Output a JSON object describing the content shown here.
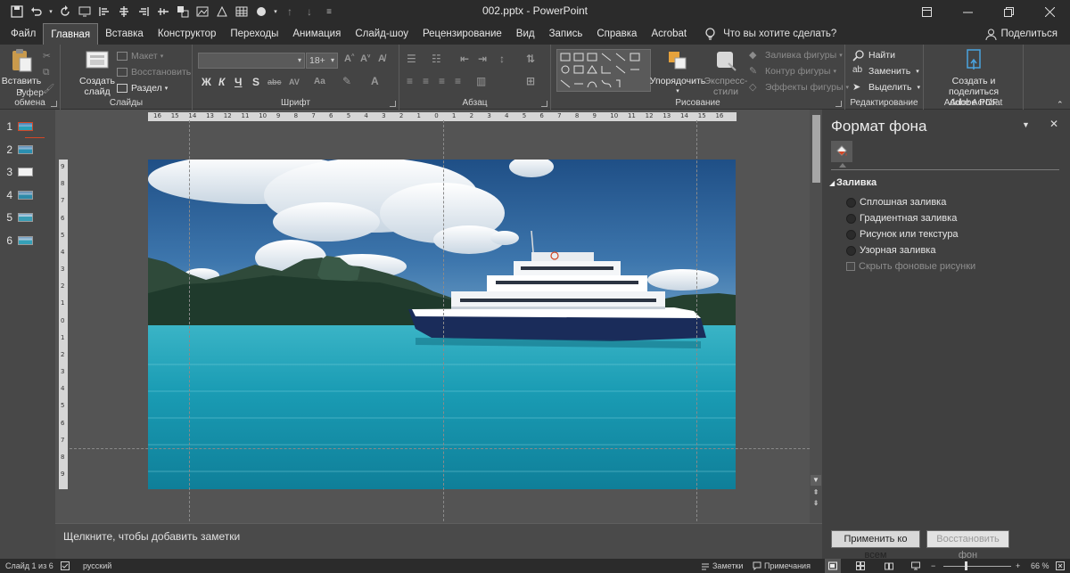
{
  "window": {
    "title": "002.pptx  -  PowerPoint"
  },
  "tabs": [
    "Файл",
    "Главная",
    "Вставка",
    "Конструктор",
    "Переходы",
    "Анимация",
    "Слайд-шоу",
    "Рецензирование",
    "Вид",
    "Запись",
    "Справка",
    "Acrobat"
  ],
  "active_tab": "Главная",
  "tell_me": "Что вы хотите сделать?",
  "share_label": "Поделиться",
  "ribbon": {
    "clipboard": {
      "paste": "Вставить",
      "label": "Буфер обмена"
    },
    "slides": {
      "new_slide_1": "Создать",
      "new_slide_2": "слайд",
      "layout": "Макет",
      "reset": "Восстановить",
      "section": "Раздел",
      "label": "Слайды"
    },
    "font": {
      "font_name": "",
      "font_size": "18+",
      "bold": "Ж",
      "italic": "К",
      "underline": "Ч",
      "shadow": "S",
      "strike": "abc",
      "spacing": "AV",
      "case": "Aa",
      "label": "Шрифт"
    },
    "paragraph": {
      "label": "Абзац"
    },
    "drawing": {
      "arrange": "Упорядочить",
      "styles_1": "Экспресс-",
      "styles_2": "стили",
      "fill": "Заливка фигуры",
      "outline": "Контур фигуры",
      "effects": "Эффекты фигуры",
      "label": "Рисование"
    },
    "editing": {
      "find": "Найти",
      "replace": "Заменить",
      "select": "Выделить",
      "label": "Редактирование"
    },
    "acrobat": {
      "create_1": "Создать и поделиться",
      "create_2": "Adobe PDF",
      "label": "Adobe Acrobat"
    }
  },
  "slides": [
    {
      "num": "1"
    },
    {
      "num": "2"
    },
    {
      "num": "3"
    },
    {
      "num": "4"
    },
    {
      "num": "5"
    },
    {
      "num": "6"
    }
  ],
  "hruler_labels": [
    "16",
    "15",
    "14",
    "13",
    "12",
    "11",
    "10",
    "9",
    "8",
    "7",
    "6",
    "5",
    "4",
    "3",
    "2",
    "1",
    "0",
    "1",
    "2",
    "3",
    "4",
    "5",
    "6",
    "7",
    "8",
    "9",
    "10",
    "11",
    "12",
    "13",
    "14",
    "15",
    "16"
  ],
  "vruler_labels": [
    "9",
    "8",
    "7",
    "6",
    "5",
    "4",
    "3",
    "2",
    "1",
    "0",
    "1",
    "2",
    "3",
    "4",
    "5",
    "6",
    "7",
    "8",
    "9"
  ],
  "notes_placeholder": "Щелкните, чтобы добавить заметки",
  "format_pane": {
    "title": "Формат фона",
    "section": "Заливка",
    "options": [
      "Сплошная заливка",
      "Градиентная заливка",
      "Рисунок или текстура",
      "Узорная заливка"
    ],
    "hide_bg": "Скрыть фоновые рисунки",
    "apply_all": "Применить ко всем",
    "reset_bg": "Восстановить фон"
  },
  "status": {
    "slide_counter": "Слайд 1 из 6",
    "language": "русский",
    "notes": "Заметки",
    "comments": "Примечания",
    "zoom": "66 %"
  },
  "colors": {
    "accent": "#d24726",
    "dark": "#2b2b2b"
  }
}
